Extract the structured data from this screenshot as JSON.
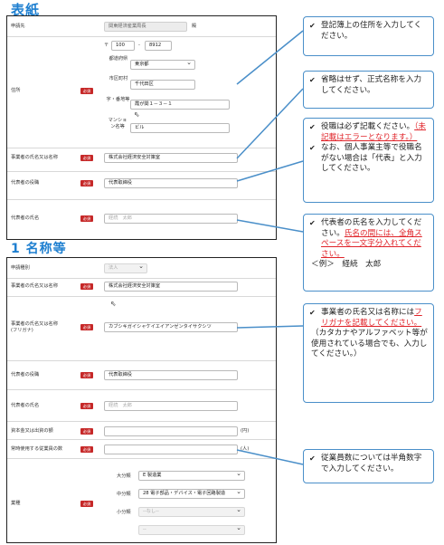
{
  "sections": {
    "cover_title": "表紙",
    "name_title": "1 名称等"
  },
  "cover": {
    "shinsei_label": "申請先",
    "shinsei_value": "関東経済産業局長",
    "shinsei_suffix": "殿",
    "address_label": "住所",
    "postal_prefix": "〒",
    "postal_1": "100",
    "postal_dash": "-",
    "postal_2": "8912",
    "pref_label": "都道府県",
    "pref_value": "東京都",
    "city_label": "市区町村",
    "city_value": "千代田区",
    "street_label": "字・番地等",
    "street_value": "霞が関１－３－１",
    "building_label": "マンション名等",
    "building_value": "ビル",
    "company_label": "事業者の氏名又は名称",
    "company_value": "株式会社経済安全対策室",
    "rep_title_label": "代表者の役職",
    "rep_title_value": "代表取締役",
    "rep_name_label": "代表者の氏名",
    "rep_name_placeholder": "経続　太郎"
  },
  "name_section": {
    "type_label": "申請種別",
    "type_value": "法人",
    "company_label": "事業者の氏名又は名称",
    "company_value": "株式会社経済安全対策室",
    "kana_label": "事業者の氏名又は名称\n(フリガナ)",
    "kana_value": "カブシキガイシャケイエイアンゼンタイサクシツ",
    "rep_title_label": "代表者の役職",
    "rep_title_value": "代表取締役",
    "rep_name_label": "代表者の氏名",
    "rep_name_placeholder": "経続　太郎",
    "capital_label": "資本金又は出資の額",
    "capital_unit": "(円)",
    "employees_label": "常時使用する従業員の数",
    "employees_unit": "(人)",
    "industry_label": "業種",
    "major_label": "大分類",
    "major_value": "E 製造業",
    "middle_label": "中分類",
    "middle_value": "28 電子部品・デバイス・電子回路製造",
    "minor_label": "小分類",
    "minor_value": "--なし--",
    "detail_value": "--"
  },
  "required_badge": "必須",
  "callouts": {
    "c1": [
      "登記簿上の住所を入力してください。"
    ],
    "c2": [
      "省略はせず、正式名称を入力してください。"
    ],
    "c3_a": "役職は必ず記載ください。",
    "c3_a_red": "（未記載はエラーとなります。）",
    "c3_b": "なお、個人事業主等で役職名がない場合は「代表」と入力してください。",
    "c4_a": "代表者の氏名を入力してください。",
    "c4_red": "氏名の間には、全角スペースを一文字分入れてください。",
    "c4_example": "＜例＞　経続　太郎",
    "c5_a": "事業者の氏名又は名称には",
    "c5_red": "フリガナを記載してください。",
    "c5_b": "（カタカナやアルファベット等が使用されている場合でも、入力してください。）",
    "c6": "従業員数については半角数字で入力してください。"
  },
  "colors": {
    "accent_blue": "#1e7fd0",
    "callout_border": "#4a8fc9",
    "required_red": "#c62828",
    "warning_red": "#e0242a"
  }
}
